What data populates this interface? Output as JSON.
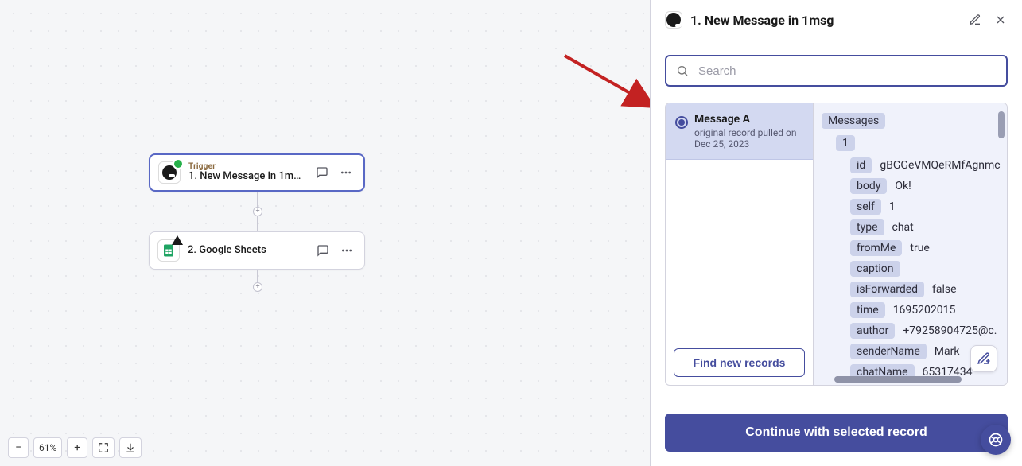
{
  "canvas": {
    "zoom_label": "61%",
    "nodes": [
      {
        "eyebrow": "Trigger",
        "title": "1. New Message in 1msg"
      },
      {
        "title": "2. Google Sheets"
      }
    ]
  },
  "panel": {
    "title": "1. New Message in 1msg",
    "search_placeholder": "Search",
    "record": {
      "name": "Message A",
      "subtitle_line1": "original record pulled on",
      "subtitle_line2": "Dec 25, 2023"
    },
    "find_button": "Find new records",
    "data_root_label": "Messages",
    "data_index_label": "1",
    "fields": [
      {
        "key": "id",
        "value": "gBGGeVMQeRMfAgnmc"
      },
      {
        "key": "body",
        "value": "Ok!"
      },
      {
        "key": "self",
        "value": "1"
      },
      {
        "key": "type",
        "value": "chat"
      },
      {
        "key": "fromMe",
        "value": "true"
      },
      {
        "key": "caption",
        "value": ""
      },
      {
        "key": "isForwarded",
        "value": "false"
      },
      {
        "key": "time",
        "value": "1695202015"
      },
      {
        "key": "author",
        "value": "+79258904725@c."
      },
      {
        "key": "senderName",
        "value": "Mark"
      },
      {
        "key": "chatName",
        "value": "65317434"
      }
    ],
    "continue_button": "Continue with selected record"
  }
}
